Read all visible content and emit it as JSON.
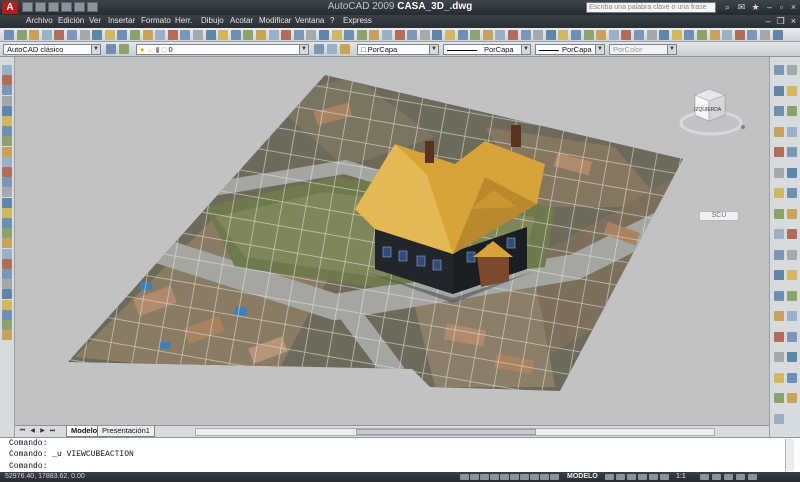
{
  "titlebar": {
    "app_name": "AutoCAD 2009",
    "file_name": "CASA_3D_.dwg",
    "search_placeholder": "Escriba una palabra clave o una frase",
    "logo": "A"
  },
  "menu": [
    "Archivo",
    "Edición",
    "Ver",
    "Insertar",
    "Formato",
    "Herr.",
    "Dibujo",
    "Acotar",
    "Modificar",
    "Ventana",
    "?",
    "Express"
  ],
  "toolbar": {
    "workspace": "AutoCAD clásico",
    "layer": "0",
    "color": "PorCapa",
    "linetype": "PorCapa",
    "lineweight": "PorCapa",
    "plotstyle": "PorColor"
  },
  "viewcube": {
    "face_label": "IZQUIERDA",
    "wcs_label": "SCU"
  },
  "tabs": [
    "Modelo",
    "Presentación1"
  ],
  "command": {
    "lines": [
      "Comando:",
      "Comando: _u VIEWCUBEACTION",
      "Comando:"
    ]
  },
  "status": {
    "coords": "52976.40, 17883.62, 0.00",
    "space": "MODELO",
    "scale": "1:1"
  },
  "colors": {
    "background": "#c1c2c4",
    "roof": "#d8a43a",
    "walls": "#1a1d22",
    "grass": "#6f7a4c",
    "road": "#9a9d97"
  },
  "icons": [
    "app-logo-icon",
    "new-icon",
    "open-icon",
    "save-icon",
    "print-icon",
    "undo-icon",
    "redo-icon",
    "help-icon",
    "pan-icon",
    "zoom-icon",
    "orbit-icon",
    "layer-icon",
    "line-icon",
    "circle-icon",
    "arc-icon",
    "hatch-icon",
    "text-icon",
    "move-icon",
    "copy-icon",
    "rotate-icon",
    "scale-icon",
    "trim-icon",
    "erase-icon",
    "close-icon",
    "minimize-icon",
    "maximize-icon"
  ]
}
